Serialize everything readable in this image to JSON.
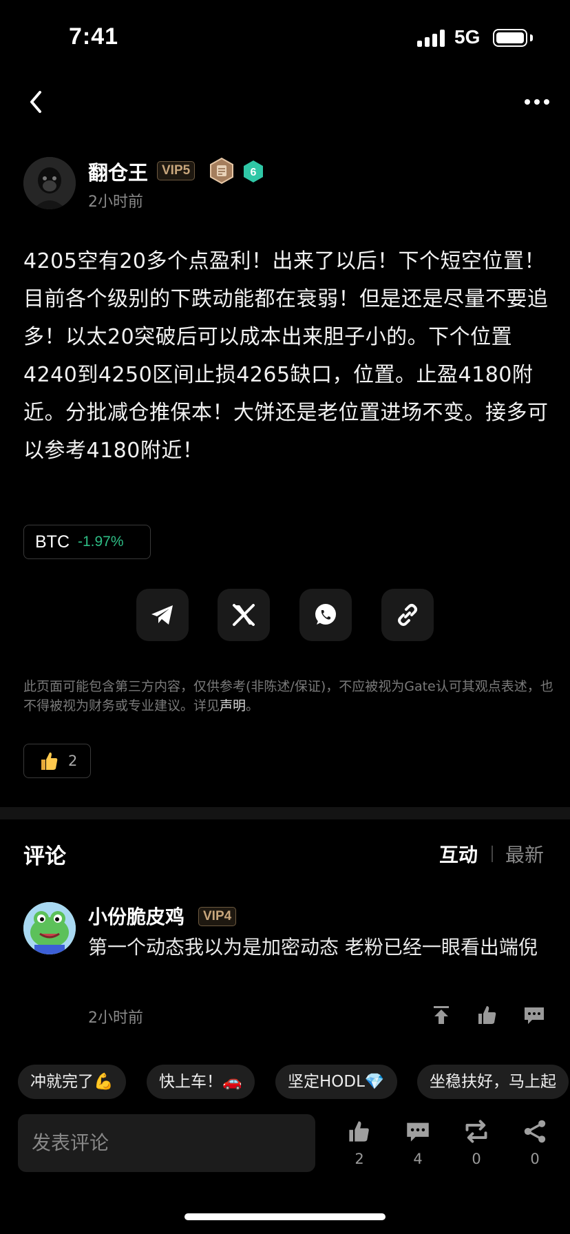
{
  "status_bar": {
    "time": "7:41",
    "network": "5G"
  },
  "post": {
    "author": {
      "name": "翻仓王",
      "vip": "VIP5",
      "level": "6"
    },
    "time": "2小时前",
    "content": "4205空有20多个点盈利！出来了以后！下个短空位置！目前各个级别的下跌动能都在衰弱！但是还是尽量不要追多！以太20突破后可以成本出来胆子小的。下个位置4240到4250区间止损4265缺口，位置。止盈4180附近。分批减仓推保本！大饼还是老位置进场不变。接多可以参考4180附近！",
    "ticker": {
      "symbol": "BTC",
      "change": "-1.97%"
    },
    "disclaimer_text": "此页面可能包含第三方内容，仅供参考(非陈述/保证)，不应被视为Gate认可其观点表述，也不得被视为财务或专业建议。详见",
    "disclaimer_link": "声明",
    "disclaimer_end": "。",
    "likes": "2"
  },
  "share_icons": [
    "telegram-icon",
    "x-icon",
    "whatsapp-icon",
    "link-icon"
  ],
  "comments_section": {
    "title": "评论",
    "tab_interact": "互动",
    "tab_latest": "最新",
    "items": [
      {
        "author": "小份脆皮鸡",
        "vip": "VIP4",
        "text": "第一个动态我以为是加密动态 老粉已经一眼看出端倪",
        "time": "2小时前"
      }
    ]
  },
  "quick_replies": [
    "冲就完了💪",
    "快上车！🚗",
    "坚定HODL💎",
    "坐稳扶好，马上起"
  ],
  "bottom_bar": {
    "input_placeholder": "发表评论",
    "like_count": "2",
    "comment_count": "4",
    "repost_count": "0",
    "share_count": "0"
  },
  "colors": {
    "background": "#000000",
    "positive": "#2ebd85",
    "vip": "#c8a67c",
    "muted": "#8a8a8a"
  }
}
